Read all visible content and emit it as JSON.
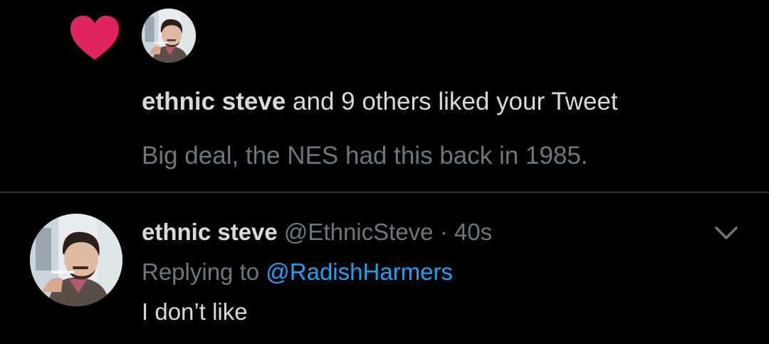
{
  "notification": {
    "icon": "heart-icon",
    "heart_color": "#e0245e",
    "liker_name": "ethnic steve",
    "action_text": " and 9 others liked your Tweet",
    "tweet_preview": "Big deal, the NES had this back in 1985."
  },
  "reply": {
    "author_name": "ethnic steve",
    "author_handle": "@EthnicSteve",
    "separator": "·",
    "timestamp": "40s",
    "replying_prefix": "Replying to ",
    "replying_handle": "@RadishHarmers",
    "text": "I don’t like",
    "menu_icon": "chevron-down-icon"
  },
  "colors": {
    "background": "#000000",
    "primary_text": "#d9d9d9",
    "secondary_text": "#6e767d",
    "link": "#1da1f2",
    "divider": "#2f3336"
  }
}
